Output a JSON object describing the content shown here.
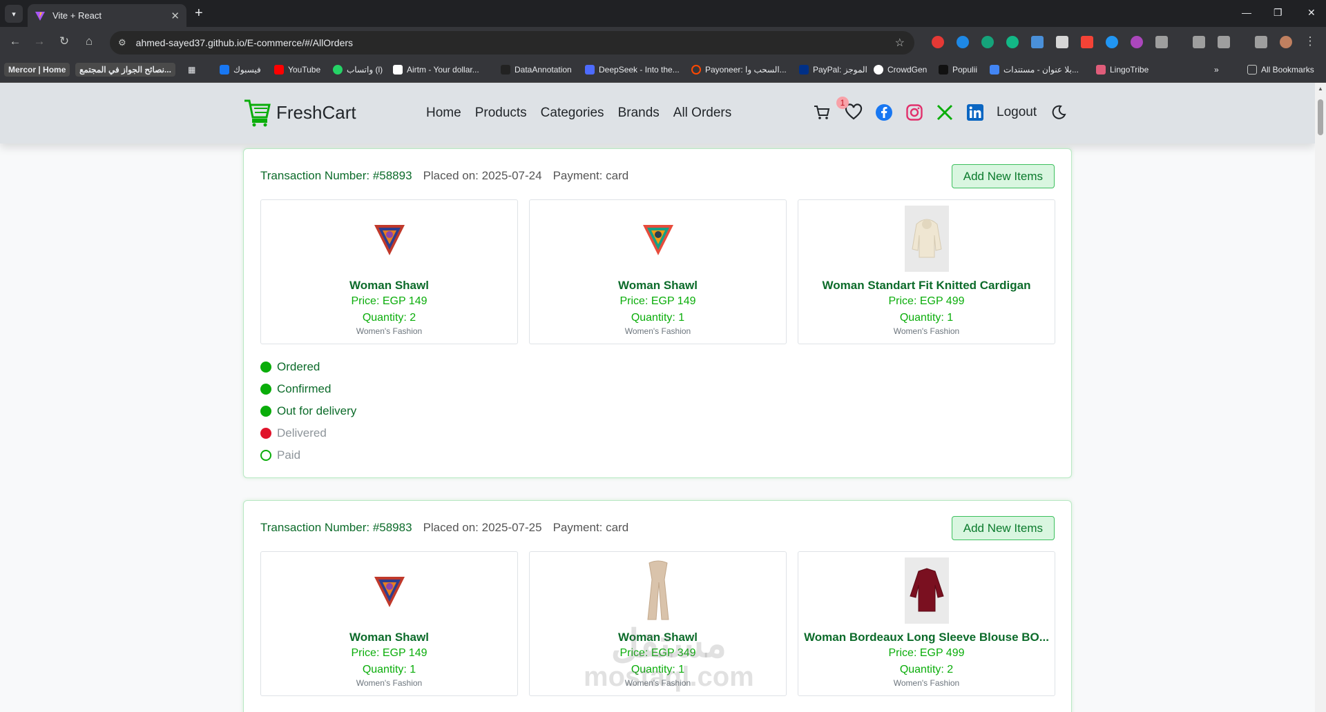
{
  "browser": {
    "tab_title": "Vite + React",
    "url": "ahmed-sayed37.github.io/E-commerce/#/AllOrders",
    "bookmarks": [
      {
        "label": "Mercor | Home"
      },
      {
        "label": "نصائح الجواز في المجتمع..."
      },
      {
        "label": "فيسبوك"
      },
      {
        "label": "YouTube"
      },
      {
        "label": "واتساب (l)"
      },
      {
        "label": "Airtm - Your dollar..."
      },
      {
        "label": "DataAnnotation"
      },
      {
        "label": "DeepSeek - Into the..."
      },
      {
        "label": "Payoneer: السحب وا..."
      },
      {
        "label": "PayPal: الموجز"
      },
      {
        "label": "CrowdGen"
      },
      {
        "label": "Populii"
      },
      {
        "label": "بلا عنوان - مستندات..."
      },
      {
        "label": "LingoTribe"
      }
    ],
    "all_bookmarks": "All Bookmarks"
  },
  "navbar": {
    "brand": "FreshCart",
    "links": [
      "Home",
      "Products",
      "Categories",
      "Brands",
      "All Orders"
    ],
    "cart_count": "1",
    "logout": "Logout"
  },
  "orders": [
    {
      "transaction": "Transaction Number: #58893",
      "placed": "Placed on: 2025-07-24",
      "payment": "Payment: card",
      "add_button": "Add New Items",
      "items": [
        {
          "name": "Woman Shawl",
          "price": "Price: EGP 149",
          "quantity": "Quantity: 2",
          "category": "Women's Fashion",
          "image": "shawl-image"
        },
        {
          "name": "Woman Shawl",
          "price": "Price: EGP 149",
          "quantity": "Quantity: 1",
          "category": "Women's Fashion",
          "image": "shawl-image"
        },
        {
          "name": "Woman Standart Fit Knitted Cardigan",
          "price": "Price: EGP 499",
          "quantity": "Quantity: 1",
          "category": "Women's Fashion",
          "image": "cardigan-image"
        }
      ],
      "statuses": [
        {
          "label": "Ordered",
          "state": "done"
        },
        {
          "label": "Confirmed",
          "state": "done"
        },
        {
          "label": "Out for delivery",
          "state": "done"
        },
        {
          "label": "Delivered",
          "state": "no"
        },
        {
          "label": "Paid",
          "state": "pending"
        }
      ]
    },
    {
      "transaction": "Transaction Number: #58983",
      "placed": "Placed on: 2025-07-25",
      "payment": "Payment: card",
      "add_button": "Add New Items",
      "items": [
        {
          "name": "Woman Shawl",
          "price": "Price: EGP 149",
          "quantity": "Quantity: 1",
          "category": "Women's Fashion",
          "image": "shawl-image"
        },
        {
          "name": "Woman Shawl",
          "price": "Price: EGP 349",
          "quantity": "Quantity: 1",
          "category": "Women's Fashion",
          "image": "scarf-image"
        },
        {
          "name": "Woman Bordeaux Long Sleeve Blouse BO...",
          "price": "Price: EGP 499",
          "quantity": "Quantity: 2",
          "category": "Women's Fashion",
          "image": "blouse-image"
        }
      ]
    }
  ],
  "watermark": {
    "arabic": "مستقل",
    "latin": "mostaql.com"
  },
  "colors": {
    "accent": "#0aad0a",
    "dark_green": "#0c6b2a",
    "red": "#e0142b",
    "navbar": "#dee2e6"
  }
}
